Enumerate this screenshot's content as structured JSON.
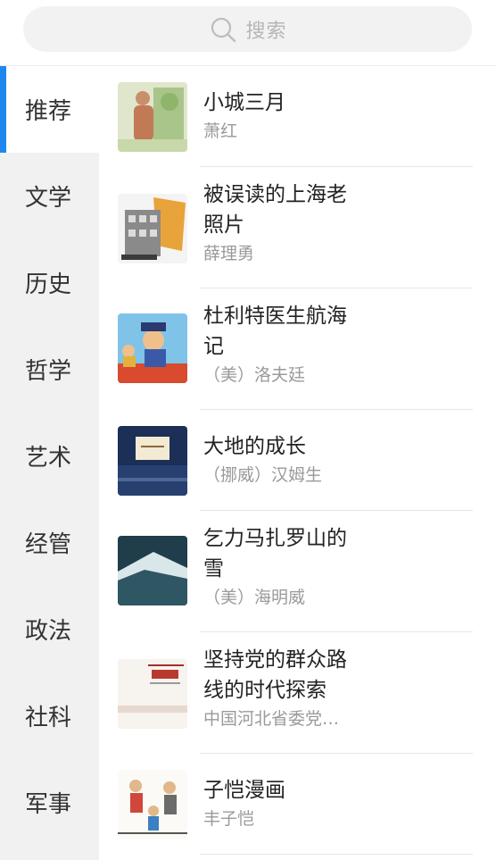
{
  "search": {
    "placeholder": "搜索"
  },
  "sidebar": {
    "items": [
      {
        "label": "推荐"
      },
      {
        "label": "文学"
      },
      {
        "label": "历史"
      },
      {
        "label": "哲学"
      },
      {
        "label": "艺术"
      },
      {
        "label": "经管"
      },
      {
        "label": "政法"
      },
      {
        "label": "社科"
      },
      {
        "label": "军事"
      }
    ],
    "active_index": 0,
    "accent_color": "#1e88f0"
  },
  "books": [
    {
      "title": "小城三月",
      "author": "萧红"
    },
    {
      "title": "被误读的上海老照片",
      "author": "薛理勇"
    },
    {
      "title": "杜利特医生航海记",
      "author": "（美）洛夫廷"
    },
    {
      "title": "大地的成长",
      "author": "（挪威）汉姆生"
    },
    {
      "title": "乞力马扎罗山的雪",
      "author": "（美）海明威"
    },
    {
      "title": "坚持党的群众路线的时代探索",
      "author": "中国河北省委党…"
    },
    {
      "title": "子恺漫画",
      "author": "丰子恺"
    }
  ]
}
